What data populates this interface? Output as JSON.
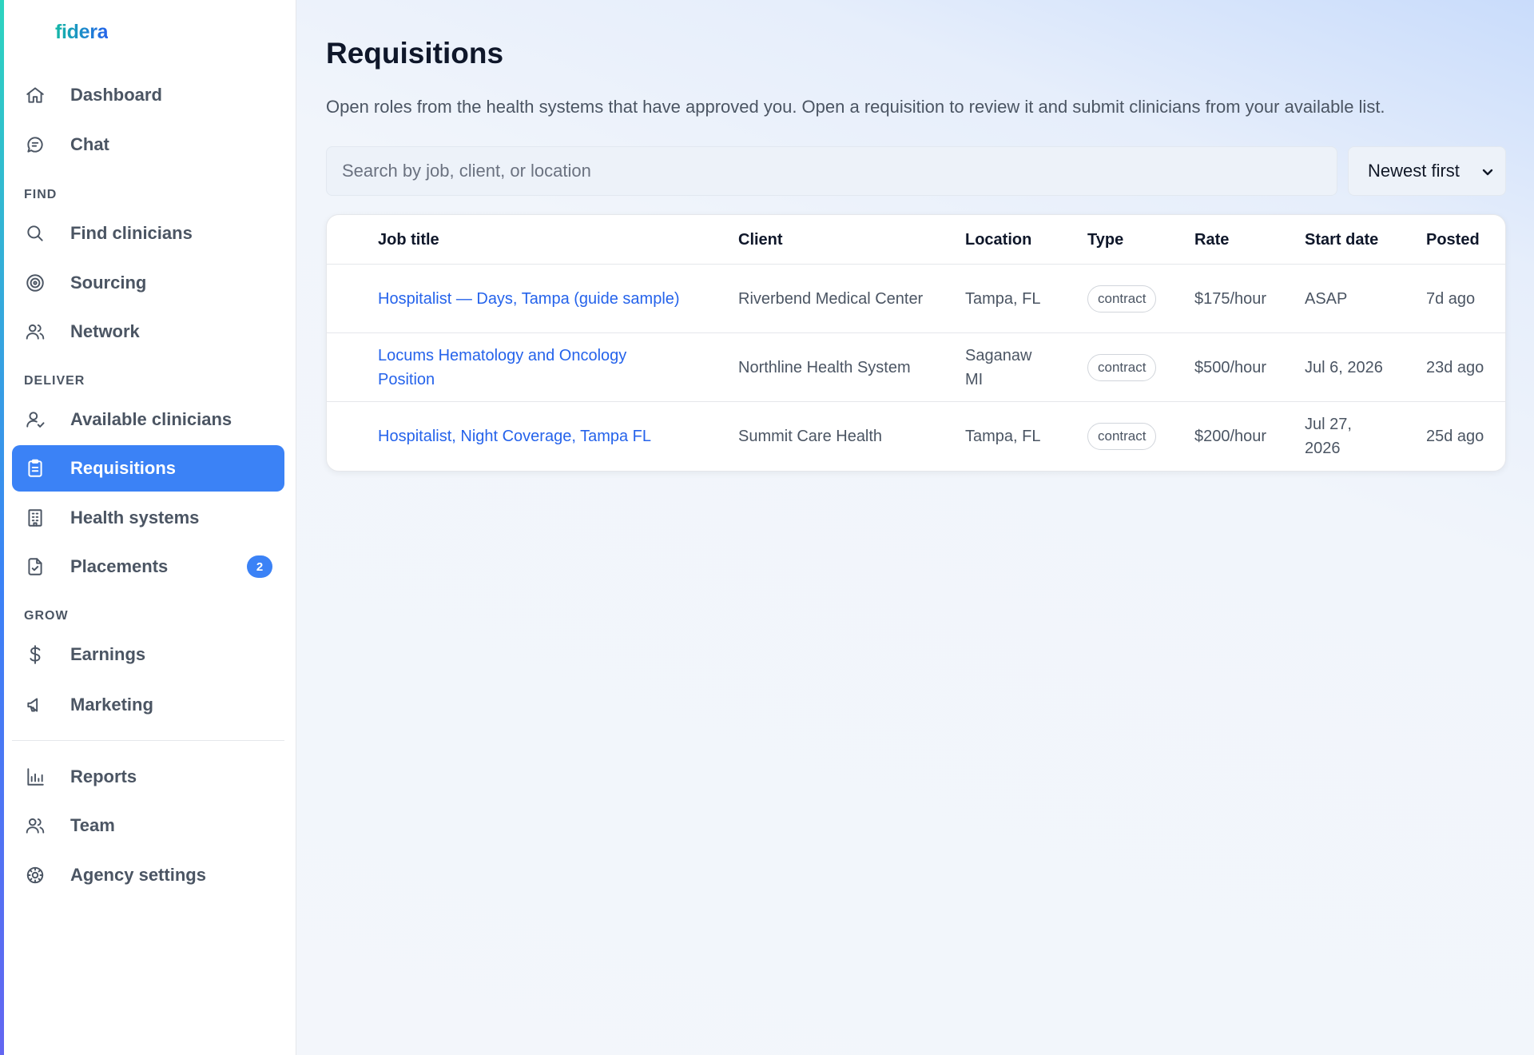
{
  "brand": {
    "name": "fidera"
  },
  "sidebar": {
    "top_items": [
      {
        "label": "Dashboard",
        "icon": "home-icon"
      },
      {
        "label": "Chat",
        "icon": "chat-icon"
      }
    ],
    "sections": [
      {
        "label": "FIND",
        "items": [
          {
            "label": "Find clinicians",
            "icon": "search-icon"
          },
          {
            "label": "Sourcing",
            "icon": "target-icon"
          },
          {
            "label": "Network",
            "icon": "users-icon"
          }
        ]
      },
      {
        "label": "DELIVER",
        "items": [
          {
            "label": "Available clinicians",
            "icon": "user-check-icon"
          },
          {
            "label": "Requisitions",
            "icon": "clipboard-icon",
            "active": true
          },
          {
            "label": "Health systems",
            "icon": "building-icon"
          },
          {
            "label": "Placements",
            "icon": "file-check-icon",
            "badge": "2"
          }
        ]
      },
      {
        "label": "GROW",
        "items": [
          {
            "label": "Earnings",
            "icon": "dollar-icon"
          },
          {
            "label": "Marketing",
            "icon": "megaphone-icon"
          }
        ]
      }
    ],
    "bottom_items": [
      {
        "label": "Reports",
        "icon": "bar-chart-icon"
      },
      {
        "label": "Team",
        "icon": "users-icon"
      },
      {
        "label": "Agency settings",
        "icon": "gear-icon"
      }
    ]
  },
  "main": {
    "title": "Requisitions",
    "description": "Open roles from the health systems that have approved you. Open a requisition to review it and submit clinicians from your available list.",
    "search": {
      "placeholder": "Search by job, client, or location",
      "value": ""
    },
    "sort": {
      "selected": "Newest first"
    },
    "table": {
      "columns": [
        "Job title",
        "Client",
        "Location",
        "Type",
        "Rate",
        "Start date",
        "Posted"
      ],
      "rows": [
        {
          "job_title": "Hospitalist — Days, Tampa (guide sample)",
          "client": "Riverbend Medical Center",
          "location": "Tampa, FL",
          "type": "contract",
          "rate": "$175/hour",
          "start_date": "ASAP",
          "posted": "7d ago"
        },
        {
          "job_title": "Locums Hematology and Oncology Position",
          "client": "Northline Health System",
          "location": "Saganaw MI",
          "type": "contract",
          "rate": "$500/hour",
          "start_date": "Jul 6, 2026",
          "posted": "23d ago"
        },
        {
          "job_title": "Hospitalist, Night Coverage, Tampa FL",
          "client": "Summit Care Health",
          "location": "Tampa, FL",
          "type": "contract",
          "rate": "$200/hour",
          "start_date": "Jul 27, 2026",
          "posted": "25d ago"
        }
      ]
    }
  },
  "colors": {
    "accent": "#3b82f6",
    "link": "#2563eb",
    "text": "#4b5563",
    "heading": "#0f172a"
  }
}
